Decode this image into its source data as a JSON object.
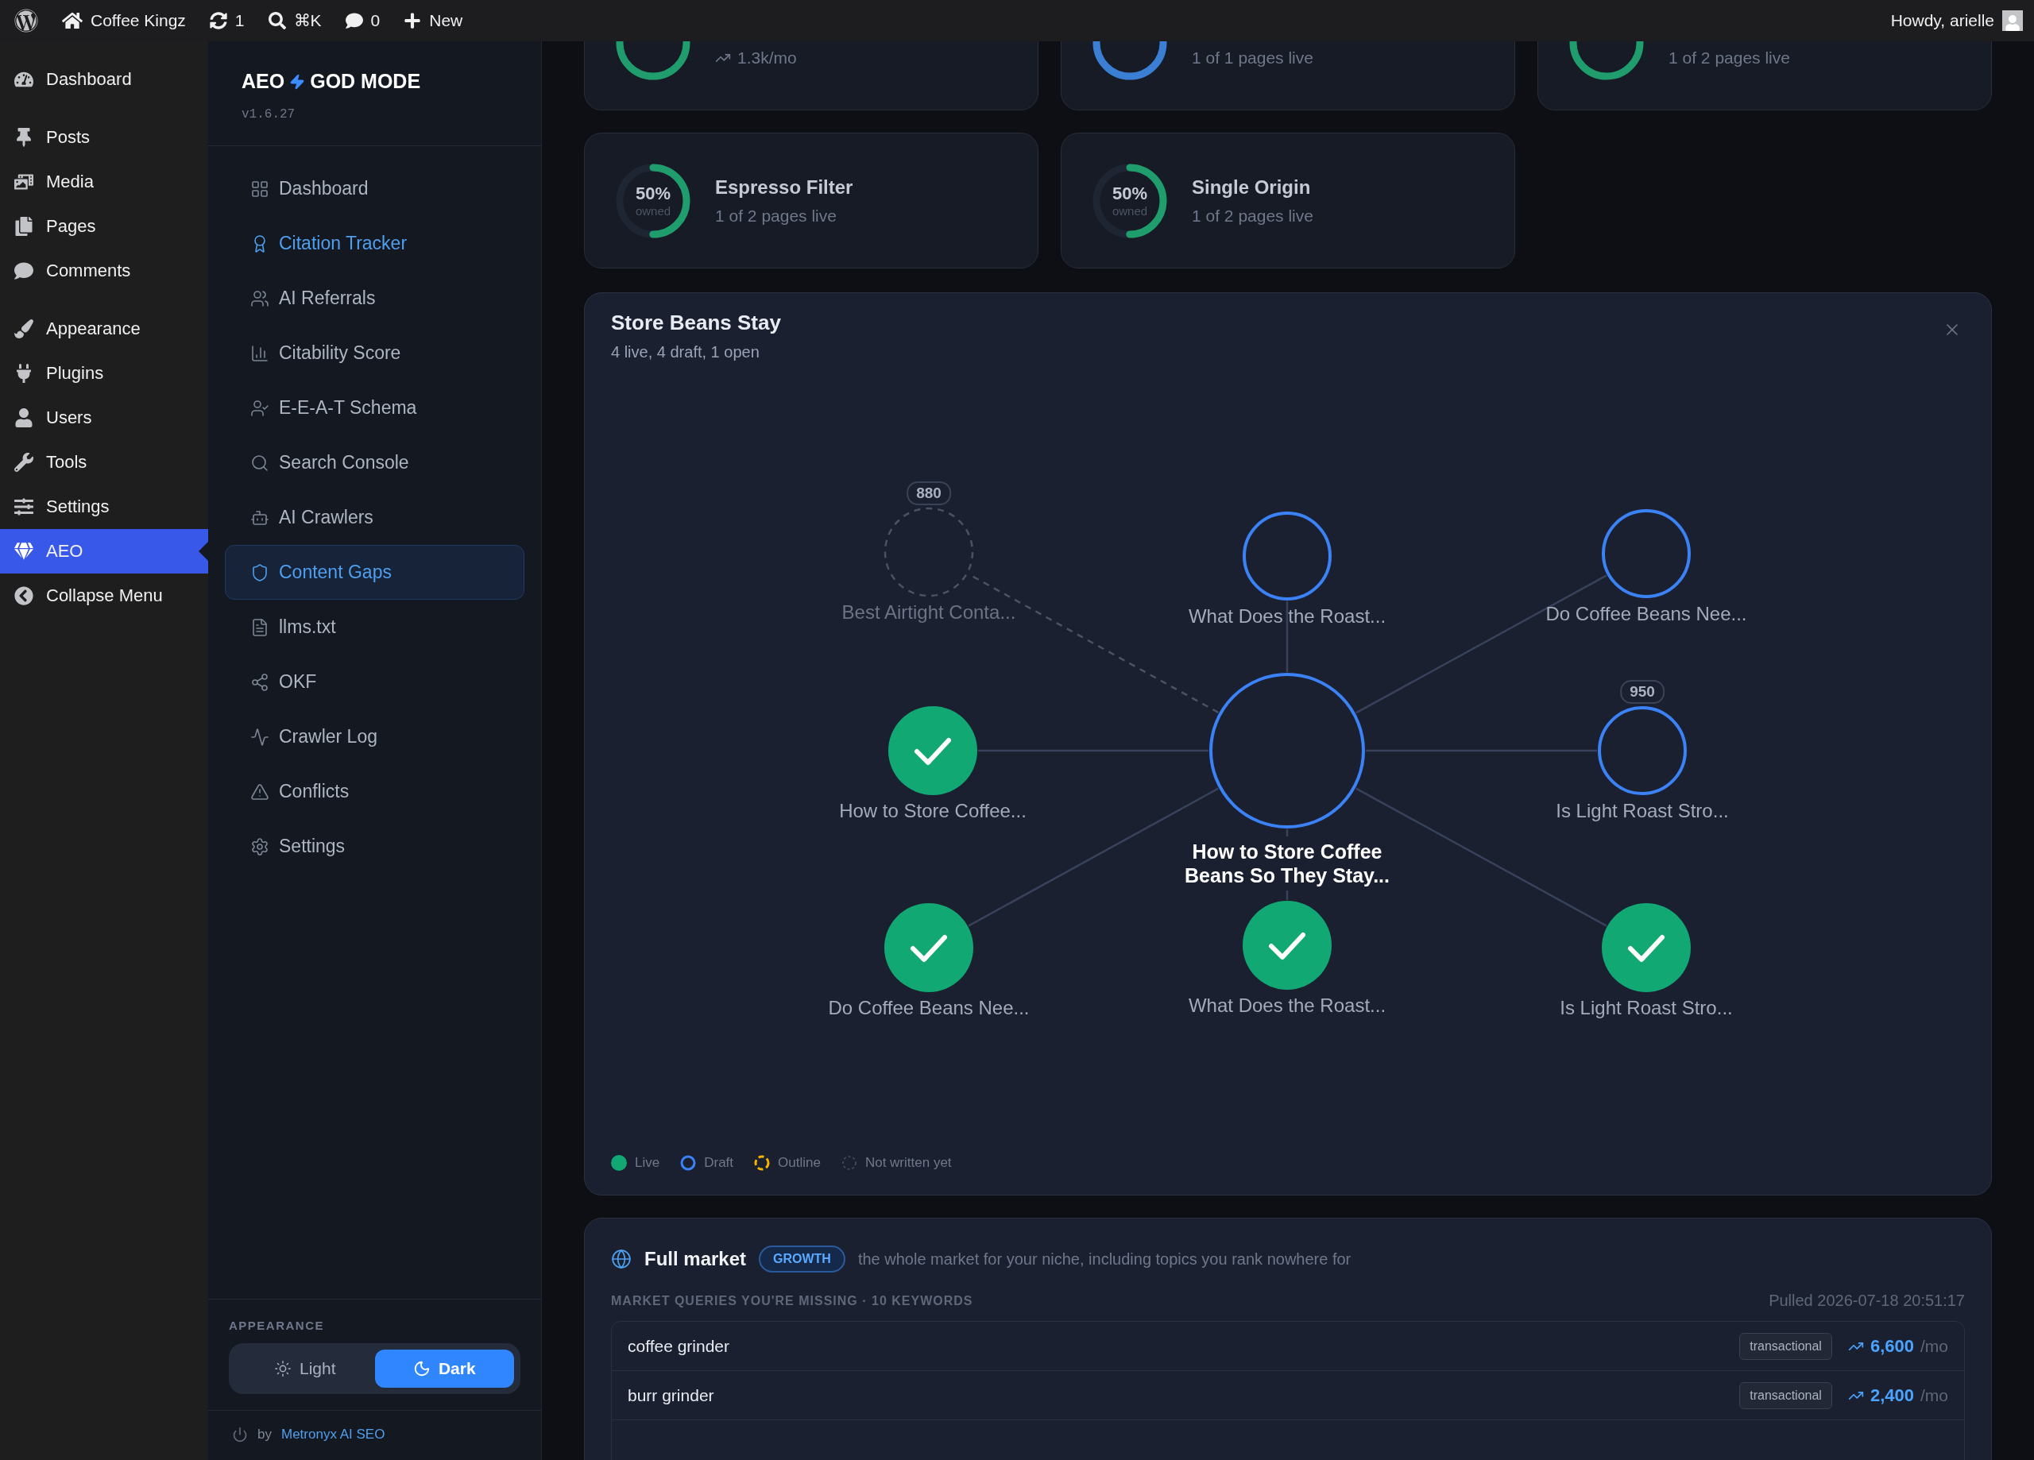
{
  "admin_bar": {
    "site": "Coffee Kingz",
    "updates": "1",
    "search_shortcut": "⌘K",
    "comments": "0",
    "new": "New",
    "greeting": "Howdy, arielle"
  },
  "wp_menu": {
    "groups": [
      {
        "items": [
          {
            "label": "Dashboard",
            "selected": false
          }
        ]
      },
      {
        "items": [
          {
            "label": "Posts",
            "selected": false
          },
          {
            "label": "Media",
            "selected": false
          },
          {
            "label": "Pages",
            "selected": false
          },
          {
            "label": "Comments",
            "selected": false
          }
        ]
      },
      {
        "items": [
          {
            "label": "Appearance",
            "selected": false
          },
          {
            "label": "Plugins",
            "selected": false
          },
          {
            "label": "Users",
            "selected": false
          },
          {
            "label": "Tools",
            "selected": false
          },
          {
            "label": "Settings",
            "selected": false
          },
          {
            "label": "AEO",
            "selected": true
          },
          {
            "label": "Collapse Menu",
            "selected": false
          }
        ]
      }
    ]
  },
  "plugin_sidebar": {
    "brand_left": "AEO",
    "brand_right": "GOD MODE",
    "version": "v1.6.27",
    "items": [
      {
        "label": "Dashboard",
        "selected": false,
        "highlighted": false
      },
      {
        "label": "Citation Tracker",
        "selected": false,
        "highlighted": true
      },
      {
        "label": "AI Referrals",
        "selected": false,
        "highlighted": false
      },
      {
        "label": "Citability Score",
        "selected": false,
        "highlighted": false
      },
      {
        "label": "E-E-A-T Schema",
        "selected": false,
        "highlighted": false
      },
      {
        "label": "Search Console",
        "selected": false,
        "highlighted": false
      },
      {
        "label": "AI Crawlers",
        "selected": false,
        "highlighted": false
      },
      {
        "label": "Content Gaps",
        "selected": true,
        "highlighted": false
      },
      {
        "label": "llms.txt",
        "selected": false,
        "highlighted": false
      },
      {
        "label": "OKF",
        "selected": false,
        "highlighted": false
      },
      {
        "label": "Crawler Log",
        "selected": false,
        "highlighted": false
      },
      {
        "label": "Conflicts",
        "selected": false,
        "highlighted": false
      },
      {
        "label": "Settings",
        "selected": false,
        "highlighted": false
      }
    ],
    "appearance": {
      "label": "APPEARANCE",
      "options": [
        {
          "label": "Light",
          "selected": false
        },
        {
          "label": "Dark",
          "selected": true
        }
      ]
    },
    "credit": {
      "prefix": "by",
      "link": "Metronyx AI SEO"
    }
  },
  "cluster_cards": [
    {
      "kind": "trend",
      "subtitle": "1.3k/mo",
      "color": "#1f9d6c"
    },
    {
      "kind": "pages",
      "subtitle": "1 of 1 pages live",
      "color": "#3b7fd4"
    },
    {
      "kind": "pages",
      "subtitle": "1 of 2 pages live",
      "color": "#1f9d6c"
    },
    {
      "kind": "pages",
      "title": "Espresso Filter",
      "percent": "50%",
      "caption": "owned",
      "subtitle": "1 of 2 pages live",
      "level": 0.5,
      "color": "#1f9d6c"
    },
    {
      "kind": "pages",
      "title": "Single Origin",
      "percent": "50%",
      "caption": "owned",
      "subtitle": "1 of 2 pages live",
      "level": 0.5,
      "color": "#1f9d6c"
    }
  ],
  "cluster_panel": {
    "title": "Store Beans Stay",
    "summary": "4 live, 4 draft, 1 open",
    "hub": {
      "label": "How to Store Coffee Beans So They Stay...",
      "kind": "draft"
    },
    "nodes": [
      {
        "label": "Best Airtight Conta...",
        "kind": "open",
        "badge": "880"
      },
      {
        "label": "What Does the Roast...",
        "kind": "draft"
      },
      {
        "label": "Do Coffee Beans Nee...",
        "kind": "draft"
      },
      {
        "label": "How to Store Coffee...",
        "kind": "live"
      },
      {
        "label": "Is Light Roast Stro...",
        "kind": "draft",
        "badge": "950"
      },
      {
        "label": "Do Coffee Beans Nee...",
        "kind": "live"
      },
      {
        "label": "What Does the Roast...",
        "kind": "live"
      },
      {
        "label": "Is Light Roast Stro...",
        "kind": "live"
      }
    ],
    "legend": [
      {
        "label": "Live",
        "kind": "live"
      },
      {
        "label": "Draft",
        "kind": "draft"
      },
      {
        "label": "Outline",
        "kind": "outline"
      },
      {
        "label": "Not written yet",
        "kind": "open"
      }
    ]
  },
  "market": {
    "title": "Full market",
    "tag": "GROWTH",
    "description": "the whole market for your niche, including topics you rank nowhere for",
    "list_label": "MARKET QUERIES YOU'RE MISSING · 10 KEYWORDS",
    "pulled": "Pulled 2026-07-18 20:51:17",
    "rows": [
      {
        "keyword": "coffee grinder",
        "intent": "transactional",
        "volume": "6,600",
        "unit": "/mo"
      },
      {
        "keyword": "burr grinder",
        "intent": "transactional",
        "volume": "2,400",
        "unit": "/mo"
      }
    ]
  }
}
